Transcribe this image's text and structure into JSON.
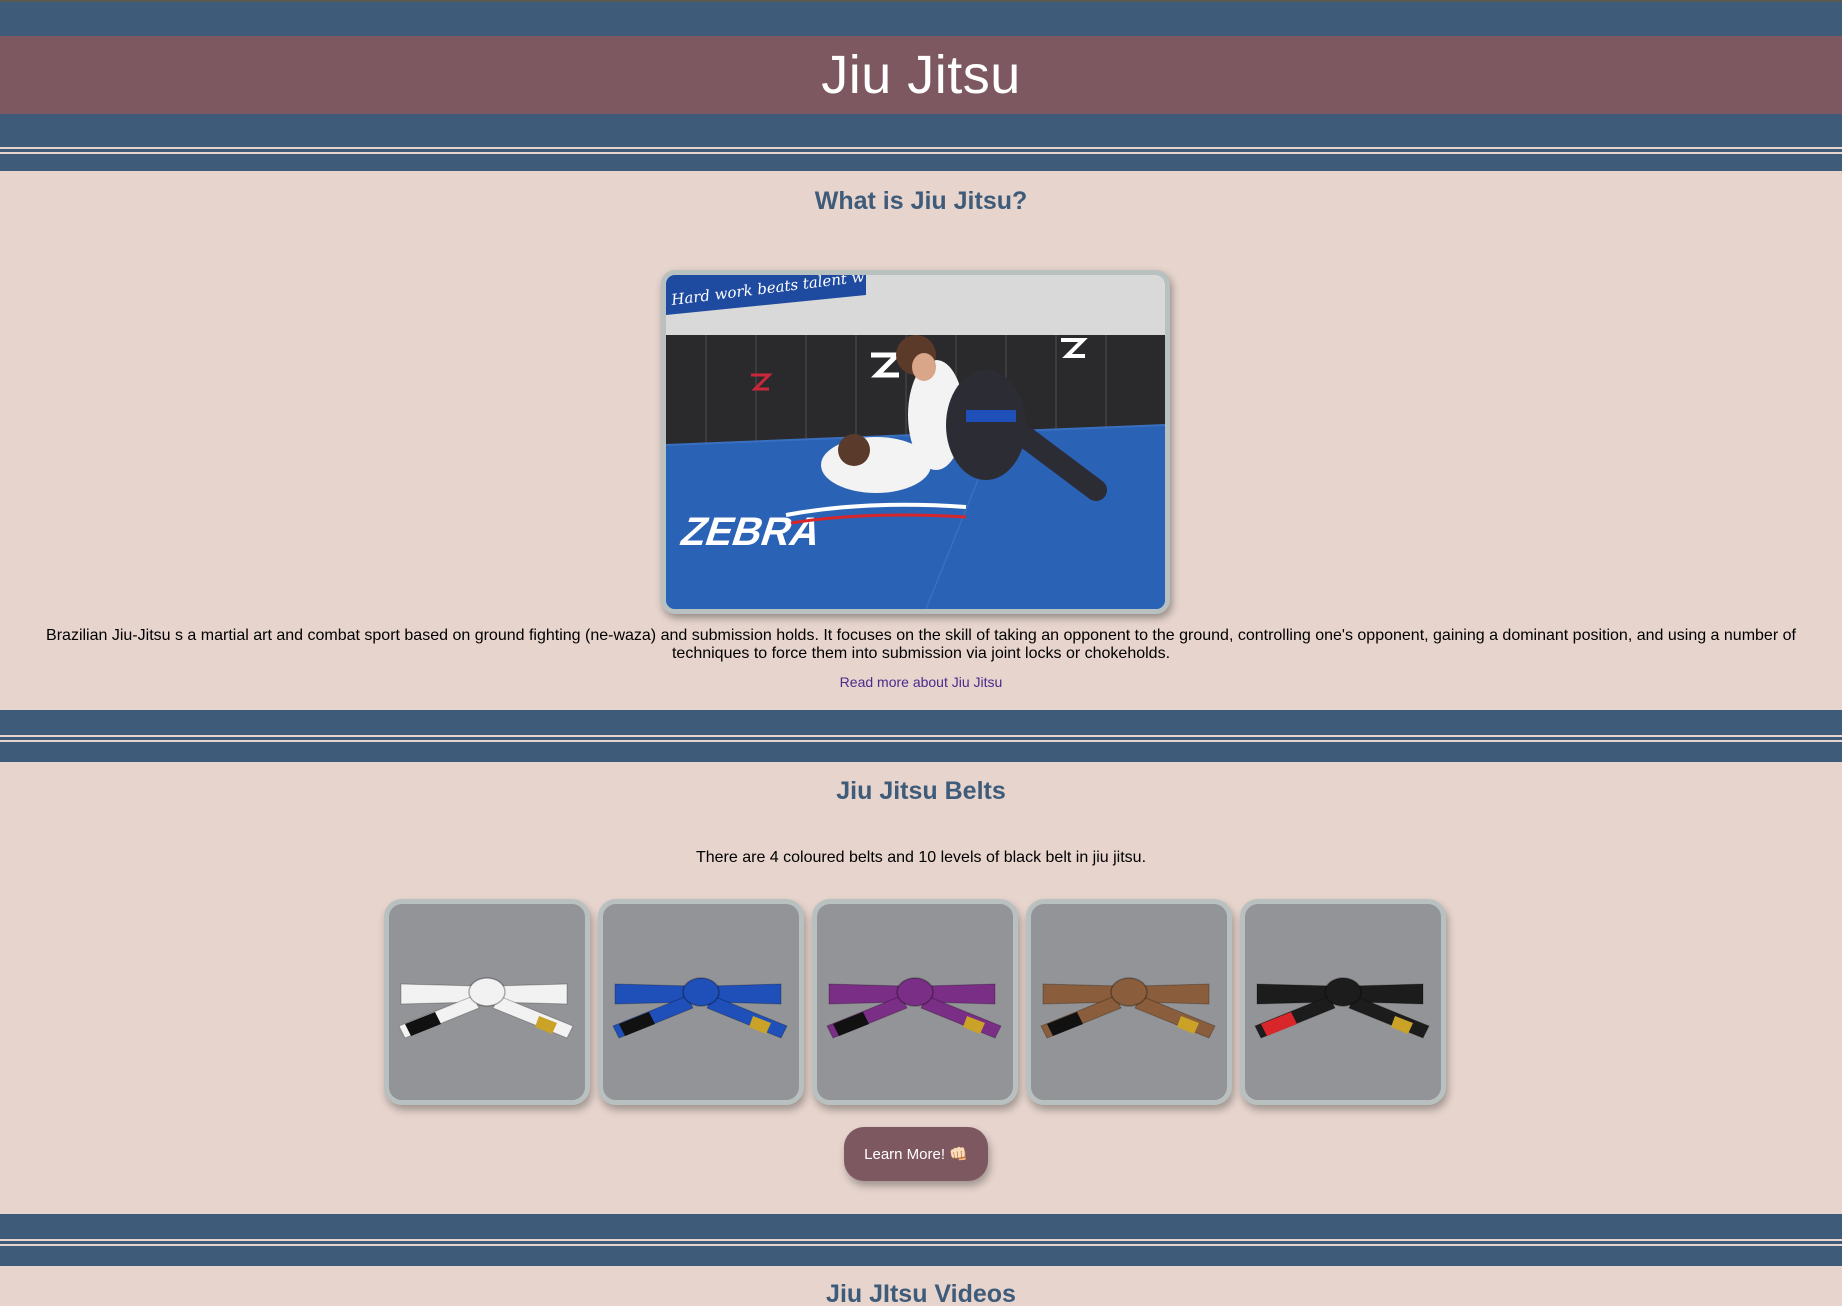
{
  "header": {
    "title": "Jiu Jitsu"
  },
  "about": {
    "heading": "What is Jiu Jitsu?",
    "description": "Brazilian Jiu-Jitsu s a martial art and combat sport based on ground fighting (ne-waza) and submission holds. It focuses on the skill of taking an opponent to the ground, controlling one's opponent, gaining a dominant position, and using a number of techniques to force them into submission via joint locks or chokeholds.",
    "read_more_label": "Read more about Jiu Jitsu",
    "photo": {
      "banner_text": "Hard work beats talent w",
      "brand_text": "ZEBRA"
    }
  },
  "belts": {
    "heading": "Jiu Jitsu Belts",
    "intro": "There are 4 coloured belts and 10 levels of black belt in jiu jitsu.",
    "items": [
      {
        "name": "white-belt",
        "color": "#f2f2f2",
        "bar": "#111111"
      },
      {
        "name": "blue-belt",
        "color": "#1f4fb8",
        "bar": "#111111"
      },
      {
        "name": "purple-belt",
        "color": "#7a2e85",
        "bar": "#111111"
      },
      {
        "name": "brown-belt",
        "color": "#8a5e3c",
        "bar": "#111111"
      },
      {
        "name": "black-belt",
        "color": "#1c1c1c",
        "bar": "#d8262b"
      }
    ],
    "learn_more_label": "Learn More! 👊🏻"
  },
  "videos": {
    "heading": "Jiu JItsu Videos"
  },
  "colors": {
    "navy": "#3e5b7a",
    "mauve": "#7e5861",
    "background": "#e6d4cd"
  }
}
